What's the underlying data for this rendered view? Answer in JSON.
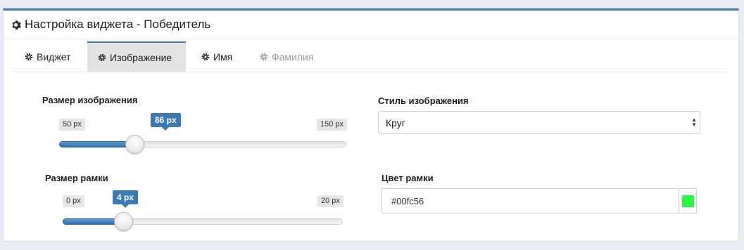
{
  "header": {
    "title": "Настройка виджета - Победитель"
  },
  "tabs": [
    {
      "label": "Виджет",
      "state": "normal"
    },
    {
      "label": "Изображение",
      "state": "active"
    },
    {
      "label": "Имя",
      "state": "normal"
    },
    {
      "label": "Фамилия",
      "state": "disabled"
    }
  ],
  "image_size": {
    "label": "Размер изображения",
    "min_label": "50 px",
    "max_label": "150 px",
    "value_label": "86 px",
    "min": 50,
    "max": 150,
    "value": 86
  },
  "border_size": {
    "label": "Размер рамки",
    "min_label": "0 px",
    "max_label": "20 px",
    "value_label": "4 px",
    "min": 0,
    "max": 20,
    "value": 4
  },
  "image_style": {
    "label": "Стиль изображения",
    "selected": "Круг"
  },
  "border_color": {
    "label": "Цвет рамки",
    "value": "#00fc56",
    "swatch": "#2cf744"
  },
  "colors": {
    "accent": "#3a7ab6",
    "tab_active_bg": "#e3e3e3"
  },
  "icons": {
    "header": "gear-icon",
    "tabs": "gear-icon"
  }
}
